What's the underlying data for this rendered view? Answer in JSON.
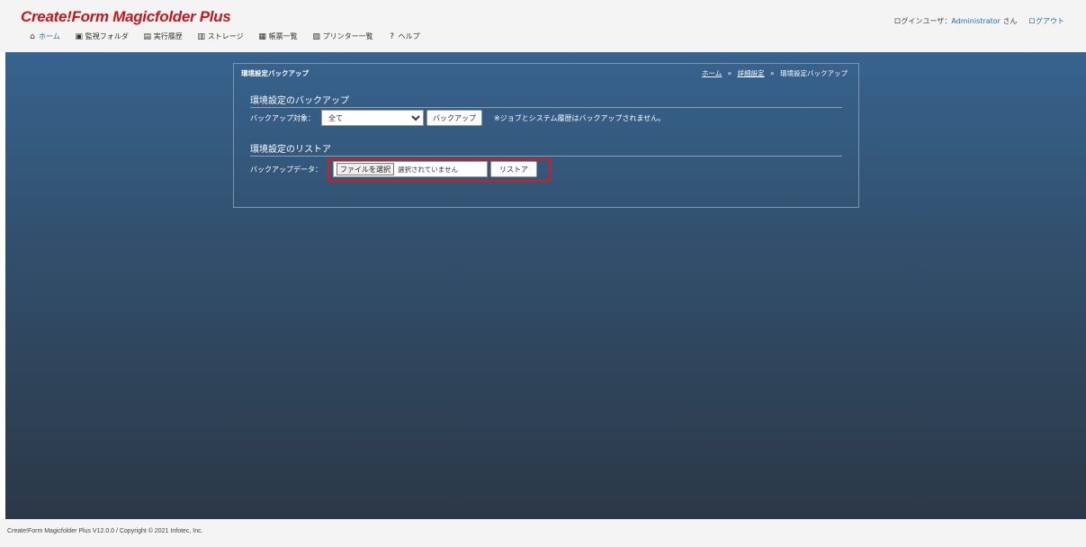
{
  "header": {
    "logo": "Create!Form Magicfolder Plus",
    "nav": [
      {
        "label": "ホーム",
        "icon": "home-icon",
        "glyph": "⌂"
      },
      {
        "label": "監視フォルダ",
        "icon": "folder-watch-icon",
        "glyph": "▣"
      },
      {
        "label": "実行履歴",
        "icon": "history-icon",
        "glyph": "▤"
      },
      {
        "label": "ストレージ",
        "icon": "storage-icon",
        "glyph": "▥"
      },
      {
        "label": "帳票一覧",
        "icon": "form-list-icon",
        "glyph": "▦"
      },
      {
        "label": "プリンター一覧",
        "icon": "printer-icon",
        "glyph": "▧"
      },
      {
        "label": "ヘルプ",
        "icon": "help-icon",
        "glyph": "?"
      }
    ],
    "user": {
      "prefix": "ログインユーザ：",
      "name": "Administrator",
      "suffix": "さん",
      "logout": "ログアウト"
    }
  },
  "panel": {
    "title": "環境設定バックアップ",
    "breadcrumb": {
      "home": "ホーム",
      "settings": "詳細設定",
      "current": "環境設定バックアップ",
      "separator": "»"
    },
    "backup": {
      "heading": "環境設定のバックアップ",
      "target_label": "バックアップ対象：",
      "target_value": "全て",
      "button": "バックアップ",
      "note": "※ジョブとシステム履歴はバックアップされません。"
    },
    "restore": {
      "heading": "環境設定のリストア",
      "data_label": "バックアップデータ：",
      "choose_file": "ファイルを選択",
      "file_status": "選択されていません",
      "button": "リストア"
    }
  },
  "footer": {
    "text": "Create!Form Magicfolder Plus V12.0.0 / Copyright © 2021 Infotec, Inc."
  },
  "colors": {
    "brand": "#c8161d",
    "link": "#2a6bb3",
    "highlight": "#d71920"
  }
}
